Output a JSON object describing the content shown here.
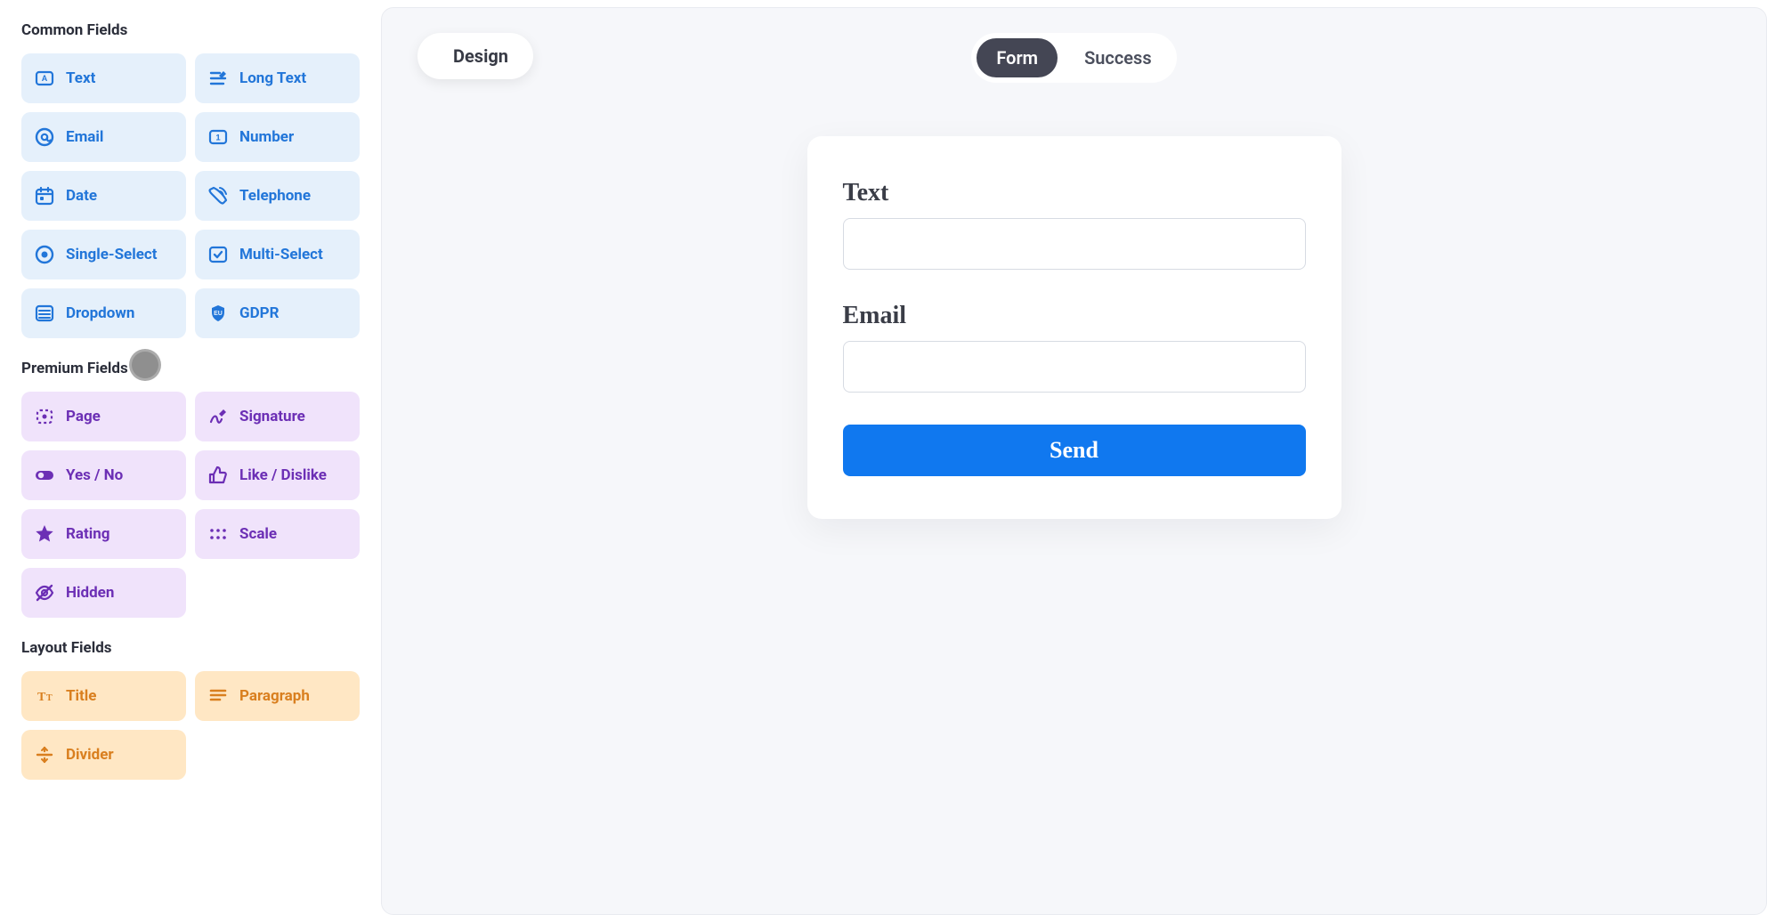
{
  "sidebar": {
    "common_header": "Common Fields",
    "premium_header": "Premium Fields",
    "layout_header": "Layout Fields",
    "common": [
      {
        "icon": "text",
        "label": "Text"
      },
      {
        "icon": "longtext",
        "label": "Long Text"
      },
      {
        "icon": "email",
        "label": "Email"
      },
      {
        "icon": "number",
        "label": "Number"
      },
      {
        "icon": "date",
        "label": "Date"
      },
      {
        "icon": "telephone",
        "label": "Telephone"
      },
      {
        "icon": "single",
        "label": "Single-Select"
      },
      {
        "icon": "multi",
        "label": "Multi-Select"
      },
      {
        "icon": "dropdown",
        "label": "Dropdown"
      },
      {
        "icon": "gdpr",
        "label": "GDPR"
      }
    ],
    "premium": [
      {
        "icon": "page",
        "label": "Page"
      },
      {
        "icon": "signature",
        "label": "Signature"
      },
      {
        "icon": "yesno",
        "label": "Yes / No"
      },
      {
        "icon": "likedislike",
        "label": "Like / Dislike"
      },
      {
        "icon": "rating",
        "label": "Rating"
      },
      {
        "icon": "scale",
        "label": "Scale"
      },
      {
        "icon": "hidden",
        "label": "Hidden"
      }
    ],
    "layout": [
      {
        "icon": "title",
        "label": "Title"
      },
      {
        "icon": "paragraph",
        "label": "Paragraph"
      },
      {
        "icon": "divider",
        "label": "Divider"
      }
    ]
  },
  "topbar": {
    "design_label": "Design",
    "tabs": {
      "form": "Form",
      "success": "Success"
    },
    "active_tab": "form"
  },
  "form": {
    "fields": [
      {
        "label": "Text",
        "type": "text"
      },
      {
        "label": "Email",
        "type": "email"
      }
    ],
    "submit_label": "Send"
  },
  "colors": {
    "common_bg": "#e5f0fb",
    "common_fg": "#2276d9",
    "premium_bg": "#f0e3fb",
    "premium_fg": "#6c2fb5",
    "layout_bg": "#ffe7c4",
    "layout_fg": "#d97f1f",
    "accent": "#1078ef"
  }
}
